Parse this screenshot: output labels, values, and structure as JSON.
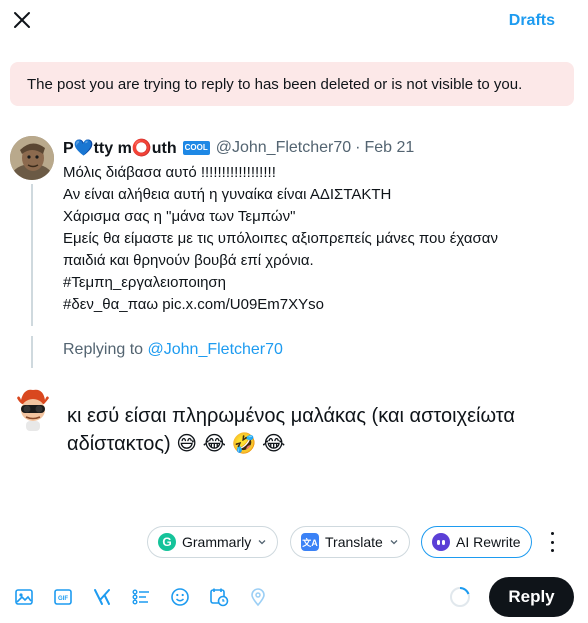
{
  "header": {
    "drafts_label": "Drafts"
  },
  "notice": {
    "text": "The post you are trying to reply to has been deleted or is not visible to you."
  },
  "original_post": {
    "author_name": "P💙tty m⭕uth",
    "badge": "COOL",
    "handle": "@John_Fletcher70",
    "separator": "·",
    "date": "Feb 21",
    "lines": [
      "Μόλις διάβασα αυτό !!!!!!!!!!!!!!!!!!",
      "Αν είναι αλήθεια αυτή η γυναίκα είναι ΑΔΙΣΤΑΚΤΗ",
      "Χάρισμα σας η \"μάνα των Τεμπών\"",
      "Εμείς θα είμαστε με τις υπόλοιπες αξιοπρεπείς μάνες που έχασαν",
      "παιδιά και θρηνούν βουβά επί χρόνια.",
      "#Τεμπη_εργαλειοποιηση",
      "#δεν_θα_παω pic.x.com/U09Em7XYso"
    ]
  },
  "replying": {
    "prefix": "Replying to",
    "handle": "@John_Fletcher70"
  },
  "compose": {
    "text": "κι εσύ είσαι πληρωμένος μαλάκας (και αστοιχείωτα αδίστακτος) 😅 😂 🤣 😂"
  },
  "assist": {
    "grammarly_label": "Grammarly",
    "grammarly_logo": "G",
    "translate_label": "Translate",
    "translate_logo": "文A",
    "ai_rewrite_label": "AI Rewrite"
  },
  "toolbar_icons": [
    "image-icon",
    "gif-icon",
    "grok-icon",
    "poll-icon",
    "emoji-icon",
    "schedule-icon",
    "location-icon"
  ],
  "actions": {
    "reply_label": "Reply"
  },
  "colors": {
    "accent": "#1d9bf0",
    "notice_bg": "#fce8e8",
    "reply_button": "#0f1419",
    "muted": "#536471"
  }
}
